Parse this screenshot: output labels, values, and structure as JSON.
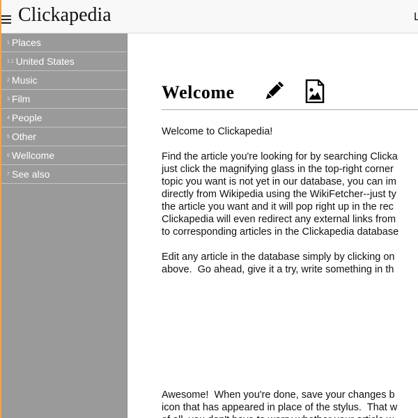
{
  "app": {
    "title": "Clickapedia",
    "topbar_right_text": "L"
  },
  "sidebar": {
    "items": [
      {
        "num": "1",
        "label": "Places"
      },
      {
        "num": "1.1",
        "label": "United States"
      },
      {
        "num": "2",
        "label": "Music"
      },
      {
        "num": "3",
        "label": "Film"
      },
      {
        "num": "4",
        "label": "People"
      },
      {
        "num": "5",
        "label": "Other"
      },
      {
        "num": "6",
        "label": "Wellcome"
      },
      {
        "num": "7",
        "label": "See also"
      }
    ]
  },
  "article": {
    "title": "Welcome",
    "edit_icon": "pencil-icon",
    "image_icon": "image-icon",
    "paragraphs": [
      "Welcome to Clickapedia!",
      "Find the article you're looking for by searching Clicka\njust click the magnifying glass in the top-right corner\ntopic you want is not yet in our database, you can im\ndirectly from Wikipedia using the WikiFetcher--just ty\nthe article you want and it will pop right up in the rec\nClickapedia will even redirect any external links from\nto corresponding articles in the Clickapedia database",
      "Edit any article in the database simply by clicking on\nabove.  Go ahead, give it a try, write something in th",
      "Awesome!  When you're done, save your changes b\nicon that has appeared in place of the stylus.  That w\nof all, you don't have to worry whether your article w"
    ]
  }
}
